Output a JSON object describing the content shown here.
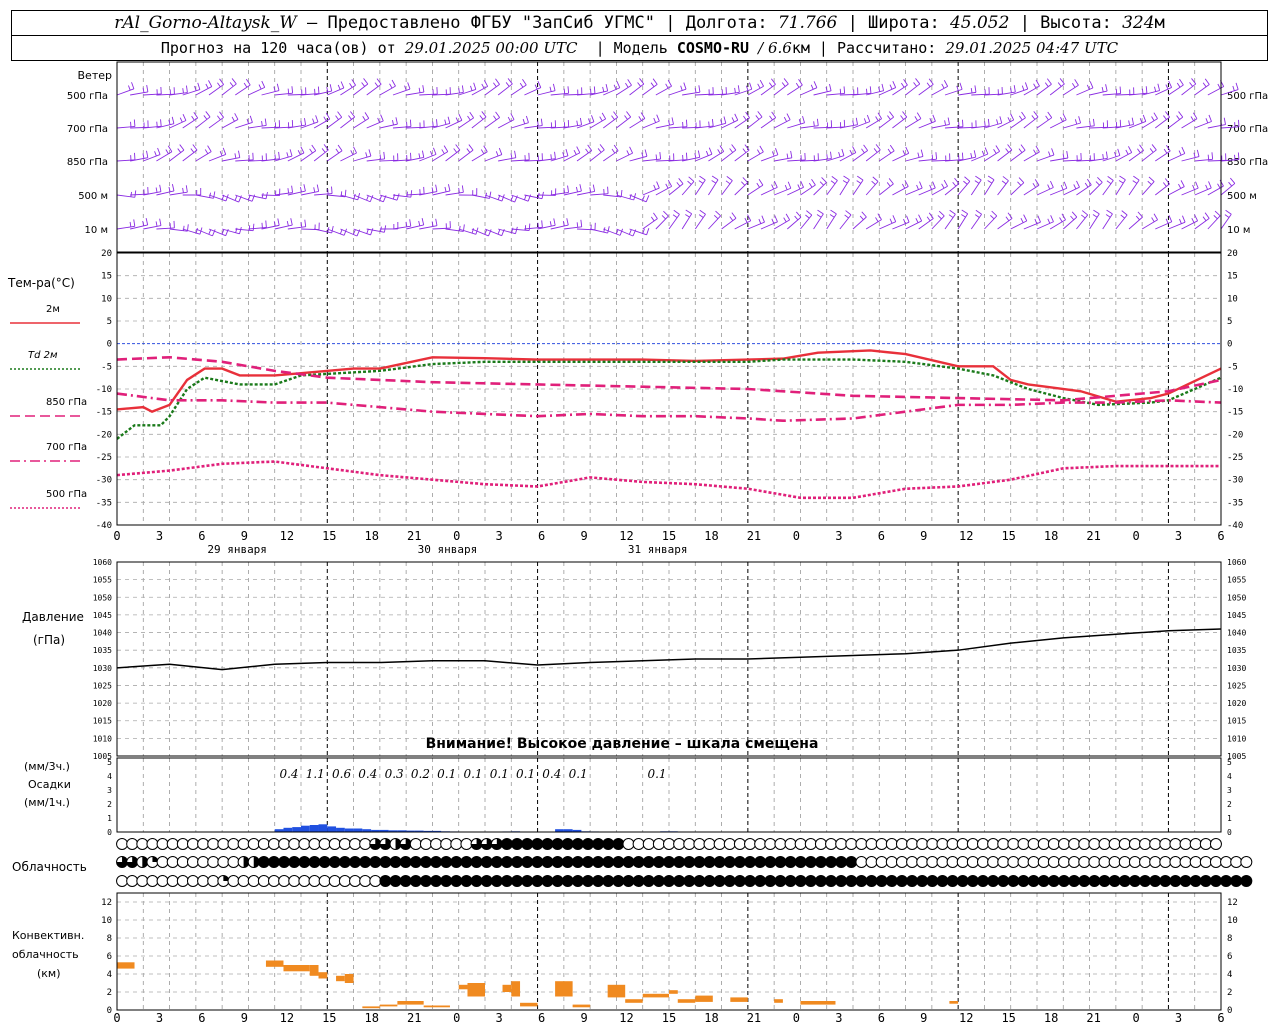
{
  "header": {
    "station": "rAl_Gorno-Altaysk_W",
    "provider": "– Предоставлено ФГБУ \"ЗапСиб УГМС\" |",
    "lon_label": "Долгота:",
    "lon": "71.766",
    "lat_label": "| Широта:",
    "lat": "45.052",
    "alt_label": "| Высота:",
    "alt": "324",
    "alt_unit": "м",
    "forecast_label": "Прогноз на 120 часа(ов)",
    "from_label": "от",
    "start": "29.01.2025 00:00 UTC",
    "model_label": "| Модель",
    "model": "COSMO-RU",
    "res": "/ 6.6",
    "res_unit": "км",
    "calc_label": "| Рассчитано:",
    "calc": "29.01.2025 04:47 UTC"
  },
  "chart_data": [
    {
      "type": "wind_barbs",
      "title": "Ветер",
      "levels": [
        "500 гПа",
        "700 гПа",
        "850 гПа",
        "500 м",
        "10  м"
      ],
      "color": "#8a2be2"
    },
    {
      "type": "line",
      "ylabel": "Тем-ра(°C)",
      "ylim": [
        -40,
        20
      ],
      "yticks": [
        20,
        15,
        10,
        5,
        0,
        -5,
        -10,
        -15,
        -20,
        -25,
        -30,
        -35,
        -40
      ],
      "x_hours_start": 0,
      "x_hours_end": 126,
      "legend": [
        {
          "label": "2м",
          "color": "#e8303a",
          "style": "solid"
        },
        {
          "label": "Td  2м",
          "color": "#1a7a1a",
          "style": "dotted"
        },
        {
          "label": "850 гПа",
          "color": "#e0207a",
          "style": "dashed"
        },
        {
          "label": "700 гПа",
          "color": "#e0207a",
          "style": "dashdot"
        },
        {
          "label": "500 гПа",
          "color": "#e0207a",
          "style": "dotted"
        }
      ],
      "series": [
        {
          "name": "2м",
          "hours": [
            0,
            3,
            4,
            6,
            8,
            10,
            12,
            14,
            18,
            21,
            27,
            30,
            36,
            42,
            48,
            54,
            60,
            66,
            72,
            76,
            80,
            86,
            90,
            96,
            100,
            102,
            104,
            106,
            110,
            114,
            118,
            120,
            126
          ],
          "values": [
            -14.5,
            -14,
            -15,
            -13.5,
            -8,
            -5.5,
            -5.5,
            -7,
            -7,
            -6.5,
            -5.5,
            -5.5,
            -3,
            -3.2,
            -3.5,
            -3.5,
            -3.5,
            -3.8,
            -3.5,
            -3.3,
            -2,
            -1.5,
            -2.3,
            -5,
            -5,
            -8,
            -9,
            -9.5,
            -10.5,
            -12.8,
            -12,
            -11,
            -5.5
          ]
        },
        {
          "name": "Td  2м",
          "hours": [
            0,
            2,
            5,
            6,
            8,
            10,
            14,
            18,
            21,
            30,
            36,
            42,
            48,
            54,
            60,
            72,
            76,
            84,
            90,
            96,
            100,
            104,
            108,
            112,
            118,
            120,
            126
          ],
          "values": [
            -21,
            -18,
            -18,
            -16,
            -10,
            -7.5,
            -9,
            -9,
            -7,
            -6,
            -4.5,
            -4,
            -4,
            -4,
            -4,
            -4,
            -3.5,
            -3.5,
            -4,
            -5.5,
            -7,
            -10,
            -12,
            -13.5,
            -13,
            -12.5,
            -7.5
          ]
        },
        {
          "name": "850 гПа",
          "hours": [
            0,
            6,
            12,
            18,
            24,
            30,
            36,
            48,
            60,
            72,
            84,
            96,
            108,
            120,
            126
          ],
          "values": [
            -3.5,
            -3,
            -4,
            -6,
            -7.5,
            -8,
            -8.5,
            -9,
            -9.5,
            -10,
            -11.5,
            -12,
            -12.5,
            -10.5,
            -8
          ]
        },
        {
          "name": "700 гПа",
          "hours": [
            0,
            6,
            12,
            18,
            24,
            30,
            36,
            42,
            48,
            54,
            60,
            66,
            72,
            76,
            84,
            90,
            96,
            102,
            108,
            114,
            120,
            126
          ],
          "values": [
            -11,
            -12.5,
            -12.5,
            -13,
            -13,
            -14,
            -15,
            -15.5,
            -16,
            -15.5,
            -16,
            -16,
            -16.5,
            -17,
            -16.5,
            -15,
            -13.5,
            -13.5,
            -13,
            -13,
            -12.5,
            -13
          ]
        },
        {
          "name": "500 гПа",
          "hours": [
            0,
            6,
            12,
            18,
            24,
            30,
            36,
            42,
            48,
            54,
            60,
            66,
            72,
            78,
            84,
            90,
            96,
            102,
            108,
            114,
            120,
            126
          ],
          "values": [
            -29,
            -28,
            -26.5,
            -26,
            -27.5,
            -29,
            -30,
            -31,
            -31.5,
            -29.5,
            -30.5,
            -31,
            -32,
            -34,
            -34,
            -32,
            -31.5,
            -30,
            -27.5,
            -27,
            -27,
            -27
          ]
        }
      ]
    },
    {
      "type": "line",
      "ylabel": "Давление",
      "yunit": "(гПа)",
      "ylim": [
        1005,
        1060
      ],
      "yticks": [
        1060,
        1055,
        1050,
        1045,
        1040,
        1035,
        1030,
        1025,
        1020,
        1015,
        1010,
        1005
      ],
      "notice": "Внимание! Высокое давление – шкала смещена",
      "series": [
        {
          "name": "Давление",
          "hours": [
            0,
            6,
            12,
            18,
            24,
            30,
            36,
            42,
            48,
            54,
            60,
            66,
            72,
            78,
            84,
            90,
            96,
            102,
            108,
            114,
            120,
            126
          ],
          "values": [
            1030,
            1031,
            1029.5,
            1031,
            1031.5,
            1031.5,
            1032,
            1032,
            1030.8,
            1031.5,
            1032,
            1032.5,
            1032.5,
            1033,
            1033.5,
            1034,
            1035,
            1037,
            1038.5,
            1039.5,
            1040.5,
            1041
          ]
        }
      ]
    },
    {
      "type": "bar",
      "ylabel_top": "(мм/3ч.)",
      "ylabel_mid": "Осадки",
      "ylabel_bot": "(мм/1ч.)",
      "ylim": [
        0,
        5
      ],
      "yticks": [
        5,
        4,
        3,
        2,
        1,
        0
      ],
      "labels": [
        {
          "hour": 21,
          "text": "0.4"
        },
        {
          "hour": 24,
          "text": "1.1"
        },
        {
          "hour": 27,
          "text": "0.6"
        },
        {
          "hour": 30,
          "text": "0.4"
        },
        {
          "hour": 33,
          "text": "0.3"
        },
        {
          "hour": 36,
          "text": "0.2"
        },
        {
          "hour": 39,
          "text": "0.1"
        },
        {
          "hour": 42,
          "text": "0.1"
        },
        {
          "hour": 45,
          "text": "0.1"
        },
        {
          "hour": 48,
          "text": "0.1"
        },
        {
          "hour": 51,
          "text": "0.4"
        },
        {
          "hour": 54,
          "text": "0.1"
        },
        {
          "hour": 63,
          "text": "0.1"
        }
      ],
      "bars": [
        {
          "hour": 19,
          "value": 0.2
        },
        {
          "hour": 20,
          "value": 0.3
        },
        {
          "hour": 21,
          "value": 0.35
        },
        {
          "hour": 22,
          "value": 0.45
        },
        {
          "hour": 23,
          "value": 0.5
        },
        {
          "hour": 24,
          "value": 0.55
        },
        {
          "hour": 25,
          "value": 0.4
        },
        {
          "hour": 26,
          "value": 0.3
        },
        {
          "hour": 27,
          "value": 0.25
        },
        {
          "hour": 28,
          "value": 0.25
        },
        {
          "hour": 29,
          "value": 0.2
        },
        {
          "hour": 30,
          "value": 0.15
        },
        {
          "hour": 31,
          "value": 0.15
        },
        {
          "hour": 32,
          "value": 0.12
        },
        {
          "hour": 33,
          "value": 0.12
        },
        {
          "hour": 34,
          "value": 0.1
        },
        {
          "hour": 35,
          "value": 0.1
        },
        {
          "hour": 36,
          "value": 0.08
        },
        {
          "hour": 37,
          "value": 0.08
        },
        {
          "hour": 38,
          "value": 0.05
        },
        {
          "hour": 39,
          "value": 0.04
        },
        {
          "hour": 42,
          "value": 0.03
        },
        {
          "hour": 45,
          "value": 0.04
        },
        {
          "hour": 46,
          "value": 0.05
        },
        {
          "hour": 51,
          "value": 0.2
        },
        {
          "hour": 52,
          "value": 0.2
        },
        {
          "hour": 53,
          "value": 0.15
        },
        {
          "hour": 54,
          "value": 0.05
        },
        {
          "hour": 55,
          "value": 0.04
        },
        {
          "hour": 63,
          "value": 0.05
        },
        {
          "hour": 64,
          "value": 0.05
        }
      ],
      "color": "#2050e0"
    },
    {
      "type": "cloud_cover",
      "ylabel": "Облачность",
      "rows": [
        "0000000000000000000000000332300000033344444444444400000000000000000000000000000000000000000000000000000000000",
        "3321000000002244444444444444444444444444444444444444444444444444444444444000000000000000000000000000000000000000",
        "0000000000100000000000000044444444444444444444444444444444444444444444444444444444444444444444444444444444444444"
      ]
    },
    {
      "type": "bar_range",
      "ylabel": "Конвективн.",
      "ylabel2": "облачность",
      "yunit": "(км)",
      "ylim": [
        0,
        13
      ],
      "yticks": [
        12,
        10,
        8,
        6,
        4,
        2,
        0
      ],
      "color": "#f08a20",
      "bars": [
        {
          "h0": 0,
          "h1": 2,
          "lo": 4.6,
          "hi": 5.3
        },
        {
          "h0": 17,
          "h1": 19,
          "lo": 4.8,
          "hi": 5.5
        },
        {
          "h0": 19,
          "h1": 22,
          "lo": 4.3,
          "hi": 5
        },
        {
          "h0": 22,
          "h1": 23,
          "lo": 3.8,
          "hi": 5
        },
        {
          "h0": 23,
          "h1": 24,
          "lo": 3.5,
          "hi": 4.2
        },
        {
          "h0": 25,
          "h1": 26,
          "lo": 3.2,
          "hi": 3.8
        },
        {
          "h0": 26,
          "h1": 27,
          "lo": 3.0,
          "hi": 4.0
        },
        {
          "h0": 28,
          "h1": 30,
          "lo": 0.2,
          "hi": 0.4
        },
        {
          "h0": 30,
          "h1": 32,
          "lo": 0.4,
          "hi": 0.6
        },
        {
          "h0": 32,
          "h1": 35,
          "lo": 0.6,
          "hi": 1.0
        },
        {
          "h0": 35,
          "h1": 38,
          "lo": 0.3,
          "hi": 0.5
        },
        {
          "h0": 39,
          "h1": 40,
          "lo": 2.3,
          "hi": 2.8
        },
        {
          "h0": 40,
          "h1": 42,
          "lo": 1.5,
          "hi": 3
        },
        {
          "h0": 44,
          "h1": 45,
          "lo": 2.0,
          "hi": 2.8
        },
        {
          "h0": 45,
          "h1": 46,
          "lo": 1.5,
          "hi": 3.2
        },
        {
          "h0": 46,
          "h1": 48,
          "lo": 0.4,
          "hi": 0.8
        },
        {
          "h0": 50,
          "h1": 52,
          "lo": 1.5,
          "hi": 3.2
        },
        {
          "h0": 52,
          "h1": 54,
          "lo": 0.3,
          "hi": 0.6
        },
        {
          "h0": 56,
          "h1": 58,
          "lo": 1.4,
          "hi": 2.8
        },
        {
          "h0": 58,
          "h1": 60,
          "lo": 0.8,
          "hi": 1.2
        },
        {
          "h0": 60,
          "h1": 63,
          "lo": 1.4,
          "hi": 1.8
        },
        {
          "h0": 63,
          "h1": 64,
          "lo": 1.8,
          "hi": 2.2
        },
        {
          "h0": 64,
          "h1": 66,
          "lo": 0.8,
          "hi": 1.2
        },
        {
          "h0": 66,
          "h1": 68,
          "lo": 0.9,
          "hi": 1.6
        },
        {
          "h0": 70,
          "h1": 72,
          "lo": 0.9,
          "hi": 1.4
        },
        {
          "h0": 75,
          "h1": 76,
          "lo": 0.8,
          "hi": 1.2
        },
        {
          "h0": 78,
          "h1": 82,
          "lo": 0.6,
          "hi": 1.0
        },
        {
          "h0": 95,
          "h1": 96,
          "lo": 0.7,
          "hi": 1.0
        }
      ]
    }
  ],
  "x_axis": {
    "tick_labels": [
      "0",
      "3",
      "6",
      "9",
      "12",
      "15",
      "18",
      "21",
      "0",
      "3",
      "6",
      "9",
      "12",
      "15",
      "18",
      "21",
      "0",
      "3",
      "6",
      "9",
      "12",
      "15",
      "18",
      "21",
      "0",
      "3",
      "6"
    ],
    "days": [
      {
        "hour": 12,
        "label": "29 января"
      },
      {
        "hour": 36,
        "label": "30 января"
      },
      {
        "hour": 60,
        "label": "31 января"
      }
    ]
  }
}
